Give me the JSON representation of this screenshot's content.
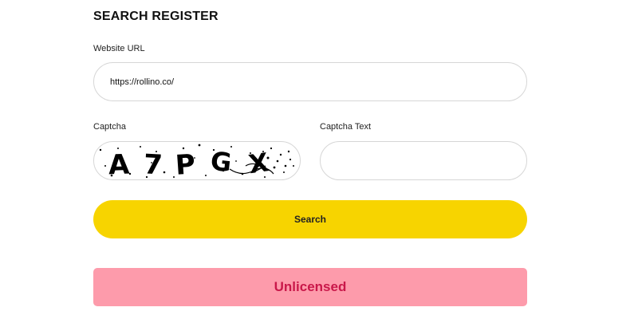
{
  "form": {
    "title": "SEARCH REGISTER",
    "url_label": "Website URL",
    "url_value": "https://rollino.co/",
    "captcha_label": "Captcha",
    "captcha_image_text": "A7PGX",
    "captcha_text_label": "Captcha Text",
    "captcha_text_value": "",
    "search_label": "Search"
  },
  "result": {
    "status": "Unlicensed"
  },
  "colors": {
    "accent_button": "#f7d400",
    "status_background": "#fd9bab",
    "status_text": "#c9184a"
  }
}
